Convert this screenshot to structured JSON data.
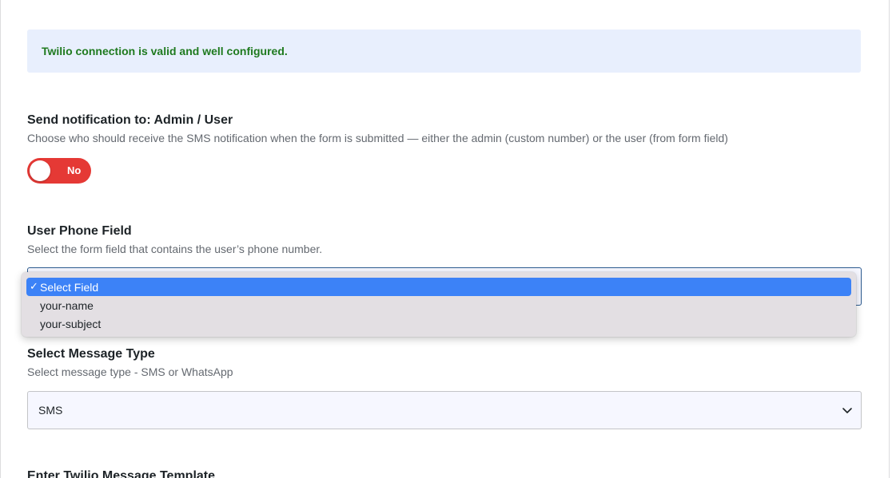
{
  "notice": {
    "text": "Twilio connection is valid and well configured."
  },
  "send_to": {
    "title": "Send notification to: Admin / User",
    "description": "Choose who should receive the SMS notification when the form is submitted — either the admin (custom number) or the user (from form field)",
    "toggle": {
      "label": "No",
      "state": "off",
      "color": "#e53935"
    }
  },
  "phone_field": {
    "title": "User Phone Field",
    "description": "Select the form field that contains the user’s phone number.",
    "options": [
      {
        "label": "Select Field",
        "selected": true,
        "check": "✓"
      },
      {
        "label": "your-name",
        "selected": false
      },
      {
        "label": "your-subject",
        "selected": false
      }
    ]
  },
  "message_type": {
    "title": "Select Message Type",
    "description": "Select message type - SMS or WhatsApp",
    "value": "SMS",
    "icon": "chevron-down-icon"
  },
  "template": {
    "title": "Enter Twilio Message Template"
  },
  "colors": {
    "accent": "#3c82f7",
    "success": "#1f7a1f",
    "toggle_off": "#e53935"
  }
}
